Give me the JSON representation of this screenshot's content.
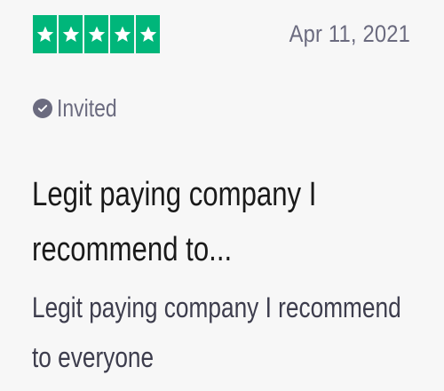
{
  "review": {
    "rating": 5,
    "rating_max": 5,
    "star_color": "#00b67a",
    "star_icon": "star-icon",
    "date": "Apr 11, 2021",
    "verification": {
      "icon": "check-circle-icon",
      "label": "Invited"
    },
    "title": "Legit paying company I recommend to...",
    "body": "Legit paying company I recommend to everyone"
  },
  "colors": {
    "background": "#f7f7f7",
    "muted_text": "#6b6b7f",
    "title_text": "#1a1a1a",
    "body_text": "#3d3d4d"
  }
}
